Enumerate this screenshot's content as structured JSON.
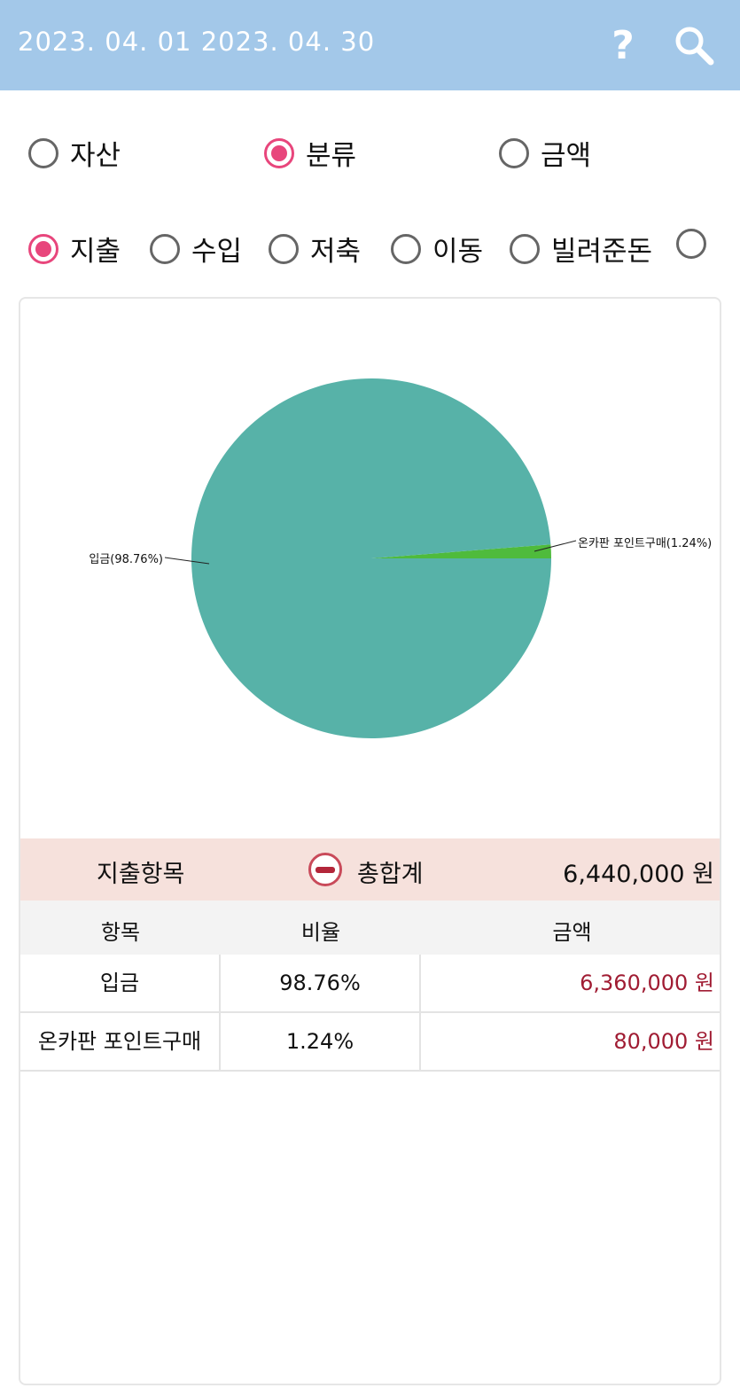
{
  "header": {
    "date_range": "2023. 04. 01  2023. 04. 30",
    "icons": [
      "help-icon",
      "search-icon"
    ]
  },
  "view_mode": {
    "options": [
      "자산",
      "분류",
      "금액"
    ],
    "selected": "분류"
  },
  "type_filter": {
    "options": [
      "지출",
      "수입",
      "저축",
      "이동",
      "빌려준돈",
      ""
    ],
    "selected": "지출"
  },
  "chart_data": {
    "type": "pie",
    "slices": [
      {
        "label": "입금(98.76%)",
        "value": 98.76,
        "color": "#57b2a8"
      },
      {
        "label": "온카판 포인트구매(1.24%)",
        "value": 1.24,
        "color": "#4fbb3c"
      }
    ]
  },
  "summary": {
    "title": "지출항목",
    "total_label": "총합계",
    "total_value": "6,440,000 원",
    "minus_icon": "minus-circle-icon"
  },
  "table": {
    "headers": [
      "항목",
      "비율",
      "금액"
    ],
    "rows": [
      {
        "item": "입금",
        "ratio": "98.76%",
        "amount": "6,360,000 원"
      },
      {
        "item": "온카판 포인트구매",
        "ratio": "1.24%",
        "amount": "80,000 원"
      }
    ]
  },
  "colors": {
    "header_bg": "#a3c8e9",
    "accent": "#e8467c",
    "summary_bg": "#f6e1dc",
    "amount_text": "#a01c33"
  }
}
